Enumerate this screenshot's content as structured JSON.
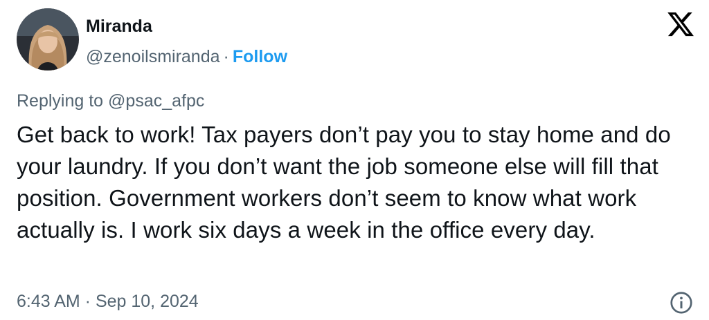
{
  "author": {
    "name": "Miranda",
    "handle": "@zenoilsmiranda",
    "separator": "·",
    "follow_label": "Follow"
  },
  "reply": {
    "prefix": "Replying to",
    "target": "@psac_afpc"
  },
  "tweet": {
    "text": "Get back to work! Tax payers don’t pay you to stay home and do your laundry. If you don’t want the job someone else will fill that position. Government workers don’t seem to know what work actually is. I work six days a week in the office every day."
  },
  "meta": {
    "timestamp": "6:43 AM · Sep 10, 2024"
  },
  "icons": {
    "brand": "x-logo-icon",
    "info": "info-icon"
  },
  "colors": {
    "text": "#0f1419",
    "secondary": "#536471",
    "accent": "#1d9bf0"
  }
}
